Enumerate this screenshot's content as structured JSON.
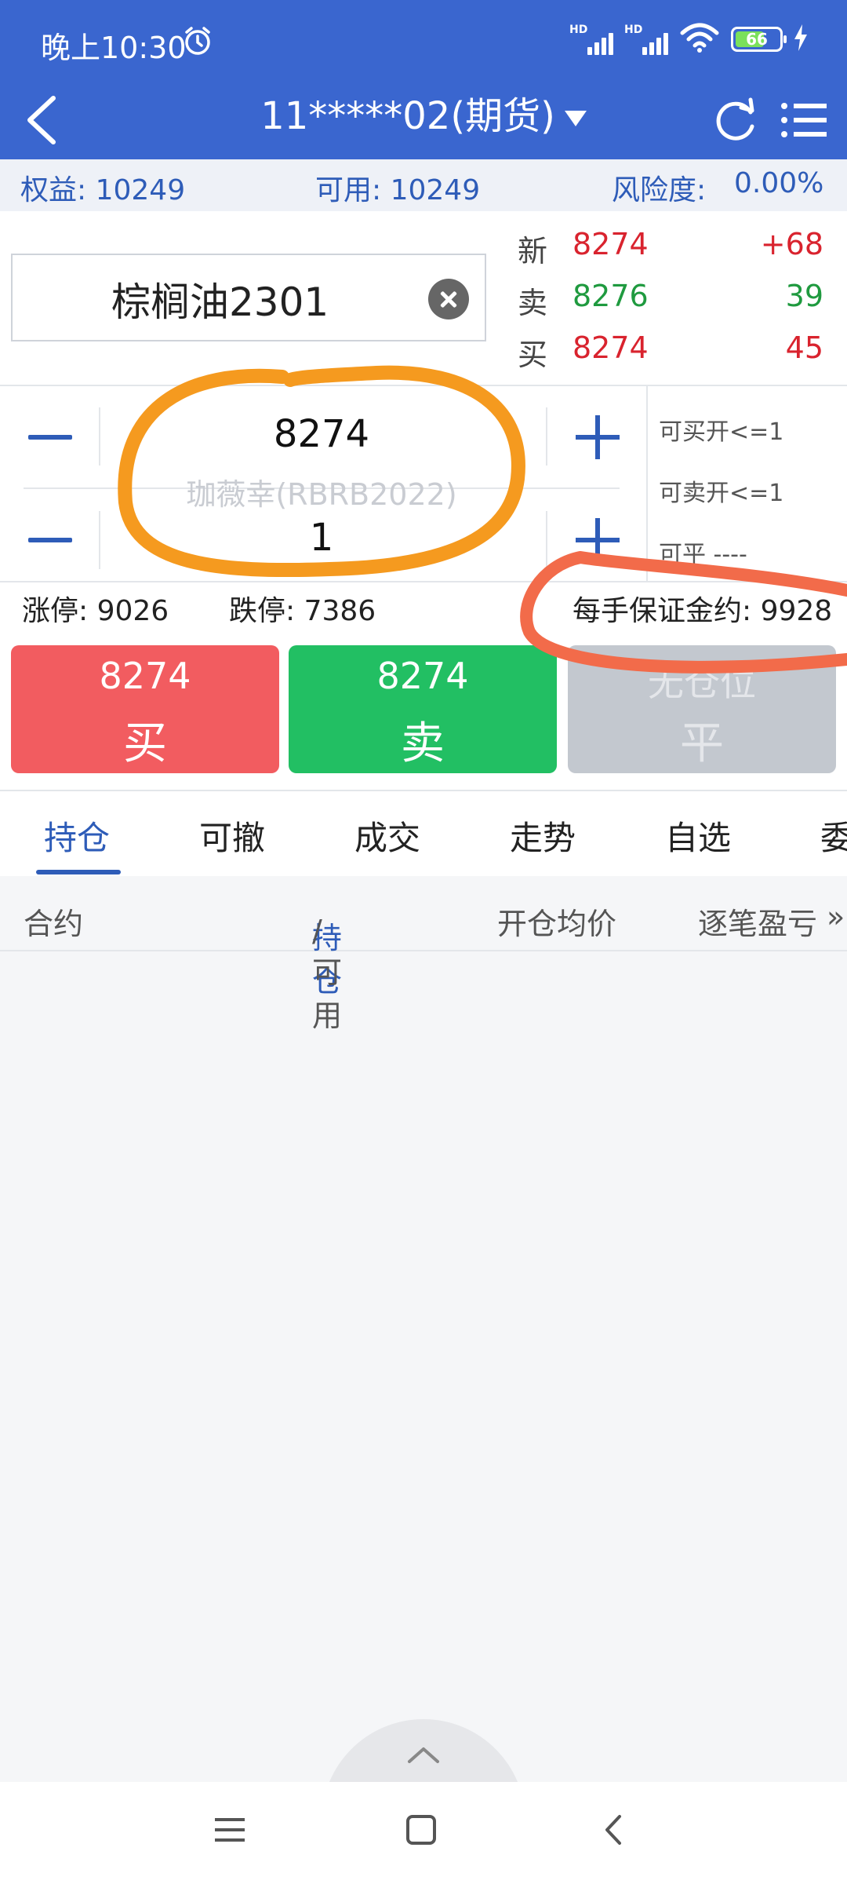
{
  "status_bar": {
    "time": "晚上10:30",
    "signal1_label": "HD",
    "signal2_label": "HD",
    "battery": "66"
  },
  "header": {
    "title": "11*****02(期货)"
  },
  "account": {
    "equity": "权益: 10249",
    "available": "可用: 10249",
    "risk_label": "风险度:",
    "risk_value": "0.00%"
  },
  "contract": {
    "name": "棕榈油2301"
  },
  "quote": {
    "last_label": "新",
    "last_price": "8274",
    "last_change": "+68",
    "ask_label": "卖",
    "ask_price": "8276",
    "ask_qty": "39",
    "bid_label": "买",
    "bid_price": "8274",
    "bid_qty": "45"
  },
  "order": {
    "price": "8274",
    "quantity": "1",
    "watermark": "珈薇幸(RBRB2022)",
    "can_buy_open": "可买开<=1",
    "can_sell_open": "可卖开<=1",
    "can_close": "可平 ----"
  },
  "limits": {
    "limit_up": "涨停: 9026",
    "limit_down": "跌停: 7386",
    "margin": "每手保证金约: 9928"
  },
  "actions": {
    "buy_price": "8274",
    "buy_label": "买",
    "sell_price": "8274",
    "sell_label": "卖",
    "close_top": "无仓位",
    "close_label": "平"
  },
  "tabs": [
    "持仓",
    "可撤",
    "成交",
    "走势",
    "自选",
    "委"
  ],
  "table": {
    "col_contract": "合约",
    "col_position": "持仓",
    "col_position_sep": "/可用",
    "col_avg_price": "开仓均价",
    "col_pnl": "逐笔盈亏",
    "col_more": "»"
  },
  "colors": {
    "brand_blue": "#3a66cf",
    "buy_red": "#f25c60",
    "sell_green": "#22bf63",
    "disabled_gray": "#c3c8cf",
    "annotation_orange": "#f59a1f",
    "annotation_coral": "#f26b4a"
  }
}
